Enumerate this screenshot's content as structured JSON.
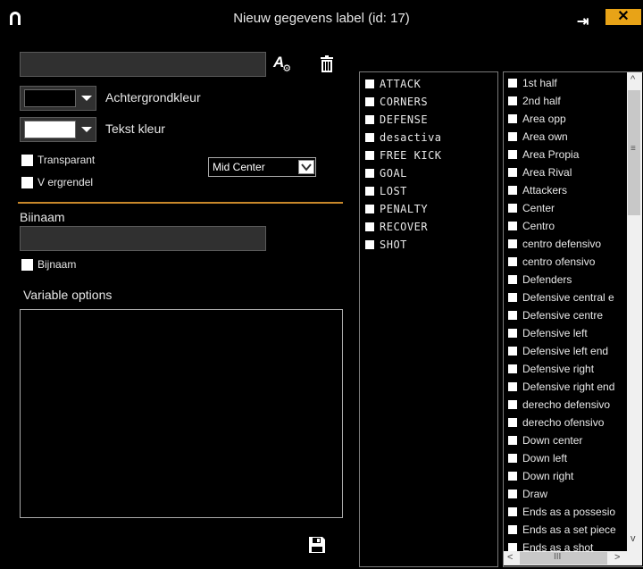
{
  "window": {
    "title": "Nieuw gegevens label (id: 17)",
    "pin_symbol": "⇥",
    "close_symbol": "✕"
  },
  "form": {
    "name_value": "",
    "background_label": "Achtergrondkleur",
    "background_color": "#000000",
    "text_color_label": "Tekst kleur",
    "text_color": "#ffffff",
    "transparent_label": "Transparant",
    "lock_label": "V ergrendel",
    "position_value": "Mid Center",
    "alias_heading": "Biinaam",
    "alias_value": "",
    "alias_checkbox_label": "Bijnaam",
    "variable_options_heading": "Variable options",
    "accent_color": "#c8882a"
  },
  "categories": [
    "ATTACK",
    "CORNERS",
    "DEFENSE",
    "desactiva",
    "FREE KICK",
    "GOAL",
    "LOST",
    "PENALTY",
    "RECOVER",
    "SHOT"
  ],
  "values": [
    "1st half",
    "2nd half",
    "Area opp",
    "Area own",
    "Area Propia",
    "Area Rival",
    "Attackers",
    "Center",
    "Centro",
    "centro defensivo",
    "centro ofensivo",
    "Defenders",
    "Defensive central e",
    "Defensive centre",
    "Defensive left",
    "Defensive left end",
    "Defensive right",
    "Defensive right end",
    "derecho defensivo",
    "derecho ofensivo",
    "Down center",
    "Down left",
    "Down right",
    "Draw",
    "Ends as a possesio",
    "Ends as a set piece",
    "Ends as a shot"
  ],
  "scrollbar": {
    "up": "^",
    "down": "v",
    "grip": "≡",
    "left": "<",
    "right": ">",
    "hgrip": "III"
  }
}
